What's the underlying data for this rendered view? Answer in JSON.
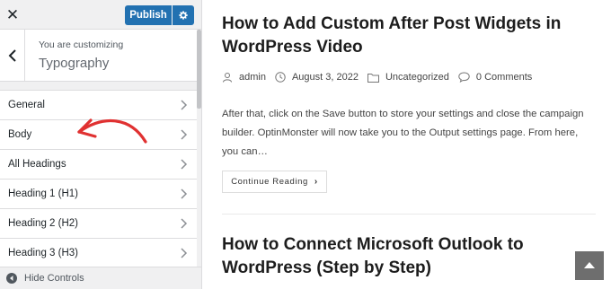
{
  "customizer": {
    "publish_label": "Publish",
    "customizing_label": "You are customizing",
    "section_title": "Typography",
    "menu_items": [
      {
        "label": "General"
      },
      {
        "label": "Body"
      },
      {
        "label": "All Headings"
      },
      {
        "label": "Heading 1 (H1)"
      },
      {
        "label": "Heading 2 (H2)"
      },
      {
        "label": "Heading 3 (H3)"
      }
    ],
    "hide_controls_label": "Hide Controls"
  },
  "preview": {
    "posts": [
      {
        "title_line1": "How to Add Custom After Post Widgets in",
        "title_line2": "WordPress Video",
        "author": "admin",
        "date": "August 3, 2022",
        "category": "Uncategorized",
        "comments": "0 Comments",
        "excerpt": "After that, click on the Save button to store your settings and close the campaign builder. OptinMonster will now take you to the Output settings page. From here, you can…",
        "continue_label": "Continue Reading"
      },
      {
        "title_line1": "How to Connect Microsoft Outlook to",
        "title_line2": "WordPress (Step by Step)"
      }
    ]
  },
  "colors": {
    "publish_blue": "#2271b1",
    "annotation_red": "#e03131",
    "panel_bg": "#f0f0f1"
  },
  "icons": [
    "close-icon",
    "gear-icon",
    "back-chevron-icon",
    "chevron-right-icon",
    "collapse-icon",
    "user-icon",
    "clock-icon",
    "folder-icon",
    "comment-icon",
    "arrow-up-icon"
  ]
}
